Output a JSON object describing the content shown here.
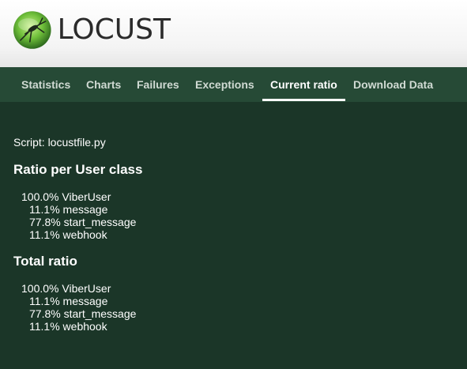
{
  "header": {
    "logo_text": "LOCUST",
    "logo_icon": "locust-icon"
  },
  "nav": {
    "tabs": [
      {
        "label": "Statistics",
        "active": false
      },
      {
        "label": "Charts",
        "active": false
      },
      {
        "label": "Failures",
        "active": false
      },
      {
        "label": "Exceptions",
        "active": false
      },
      {
        "label": "Current ratio",
        "active": true
      },
      {
        "label": "Download Data",
        "active": false
      }
    ]
  },
  "main": {
    "script_label": "Script: locustfile.py",
    "sections": [
      {
        "title": "Ratio per User class",
        "user": "100.0% ViberUser",
        "tasks": [
          "11.1% message",
          "77.8% start_message",
          "11.1% webhook"
        ]
      },
      {
        "title": "Total ratio",
        "user": "100.0% ViberUser",
        "tasks": [
          "11.1% message",
          "77.8% start_message",
          "11.1% webhook"
        ]
      }
    ]
  },
  "colors": {
    "header_bg": "#f4f4f4",
    "nav_bg": "#264a36",
    "page_bg": "#1b3628",
    "accent": "#ffffff"
  }
}
